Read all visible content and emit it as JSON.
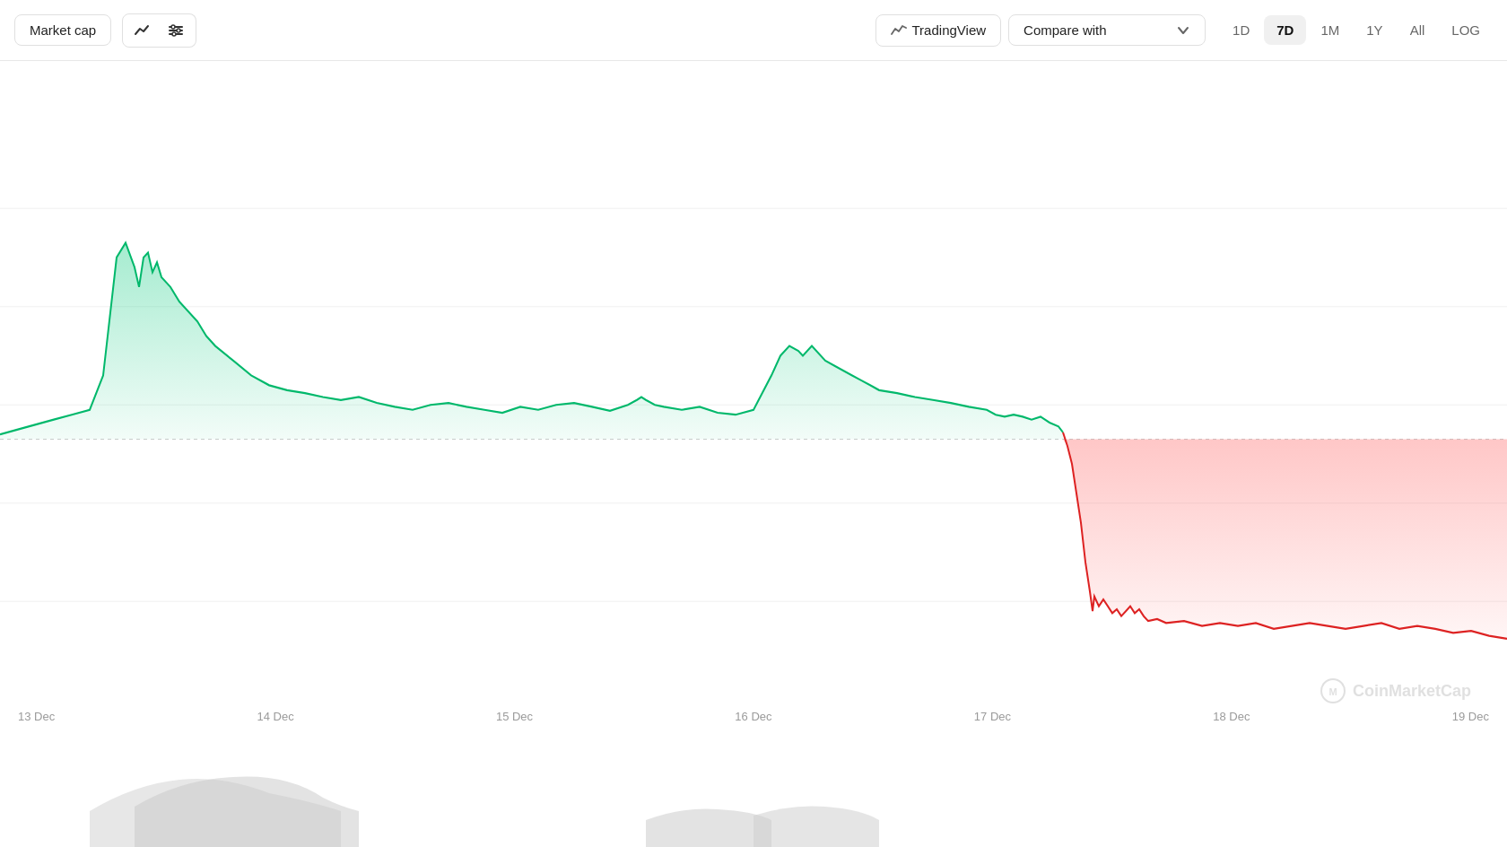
{
  "toolbar": {
    "market_cap_label": "Market cap",
    "trading_view_label": "TradingView",
    "compare_with_label": "Compare with",
    "time_periods": [
      "1D",
      "7D",
      "1M",
      "1Y",
      "All",
      "LOG"
    ],
    "active_period": "7D"
  },
  "chart": {
    "x_labels": [
      "13 Dec",
      "14 Dec",
      "15 Dec",
      "16 Dec",
      "17 Dec",
      "18 Dec",
      "19 Dec"
    ],
    "watermark": "CoinMarketCap",
    "green_color": "#00a86b",
    "green_fill": "#c8f0e0",
    "red_color": "#e03030",
    "red_fill": "#fccaca"
  },
  "icons": {
    "line_chart": "∿",
    "settings": "⊹",
    "trading_view_icon": "📈",
    "chevron_down": "⌄",
    "cmc_logo": "◎"
  }
}
